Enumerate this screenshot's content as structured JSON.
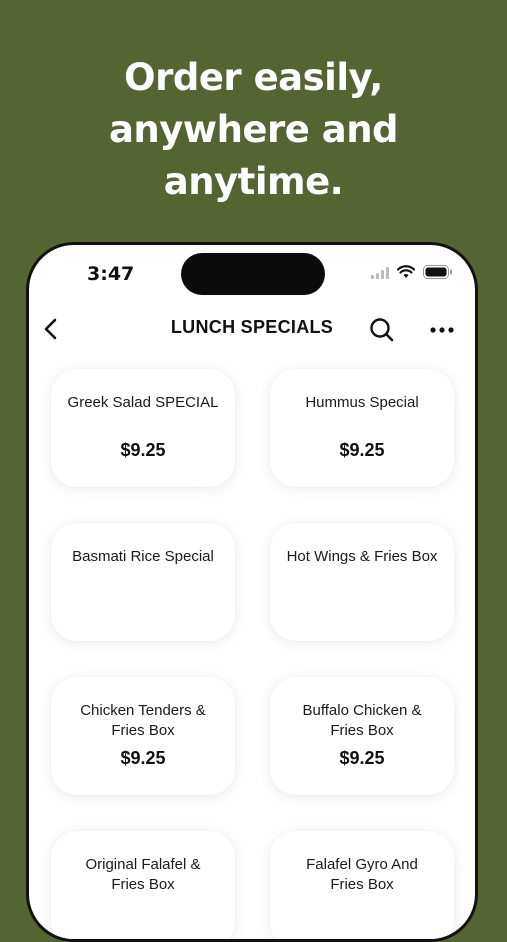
{
  "headline": [
    "Order easily,",
    "anywhere and",
    "anytime."
  ],
  "status_bar": {
    "time": "3:47"
  },
  "navbar": {
    "title": "LUNCH SPECIALS"
  },
  "icons": {
    "back": "chevron-left-icon",
    "search": "search-icon",
    "more": "more-dots-icon"
  },
  "colors": {
    "background": "#546433",
    "card": "#ffffff",
    "text": "#111111"
  },
  "items": [
    {
      "name": "Greek Salad SPECIAL",
      "price": "$9.25"
    },
    {
      "name": "Hummus Special",
      "price": "$9.25"
    },
    {
      "name": "Basmati Rice Special",
      "price": ""
    },
    {
      "name": "Hot Wings & Fries Box",
      "price": ""
    },
    {
      "name": "Chicken Tenders & Fries Box",
      "price": "$9.25"
    },
    {
      "name": "Buffalo Chicken & Fries Box",
      "price": "$9.25"
    },
    {
      "name": "Original Falafel & Fries Box",
      "price": ""
    },
    {
      "name": "Falafel Gyro And Fries Box",
      "price": ""
    }
  ]
}
